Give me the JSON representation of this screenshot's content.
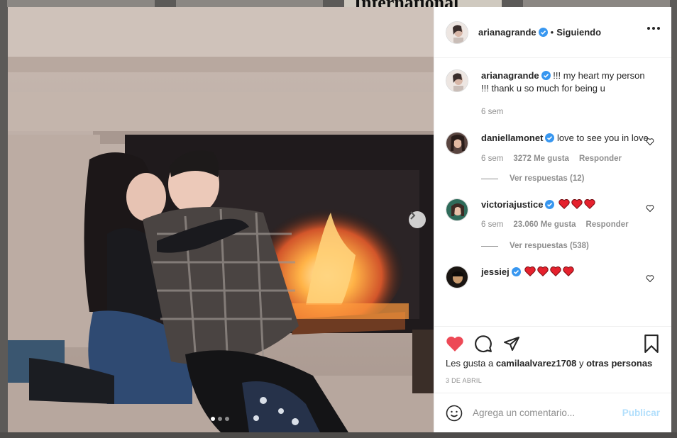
{
  "background": {
    "headline_fragment": "International"
  },
  "post": {
    "username": "arianagrande",
    "separator": "•",
    "follow_status": "Siguiendo",
    "caption": {
      "username": "arianagrande",
      "text": "!!! my heart my person !!! thank u so much for being u",
      "time": "6 sem"
    },
    "comments": [
      {
        "username": "daniellamonet",
        "text": "love to see you in love",
        "time": "6 sem",
        "likes": "3272 Me gusta",
        "reply": "Responder",
        "view_replies": "Ver respuestas (12)"
      },
      {
        "username": "victoriajustice",
        "text": "",
        "hearts": 3,
        "time": "6 sem",
        "likes": "23.060 Me gusta",
        "reply": "Responder",
        "view_replies": "Ver respuestas (538)"
      },
      {
        "username": "jessiej",
        "text": "",
        "hearts": 4
      }
    ],
    "liked_by": {
      "prefix": "Les gusta a",
      "user": "camilaalvarez1708",
      "connector": "y",
      "others": "otras personas"
    },
    "date": "3 DE ABRIL",
    "comment_box": {
      "placeholder": "Agrega un comentario...",
      "publish_label": "Publicar"
    },
    "carousel": {
      "slides": 3,
      "active": 1
    }
  },
  "colors": {
    "liked_heart": "#ed4956",
    "verified": "#3897f0",
    "publish_disabled": "#b2dffc",
    "secondary_text": "#8e8e8e"
  },
  "icons": [
    "more-options-icon",
    "chevron-right-icon",
    "heart-icon",
    "comment-icon",
    "share-icon",
    "bookmark-icon",
    "emoji-icon",
    "verified-badge-icon"
  ]
}
